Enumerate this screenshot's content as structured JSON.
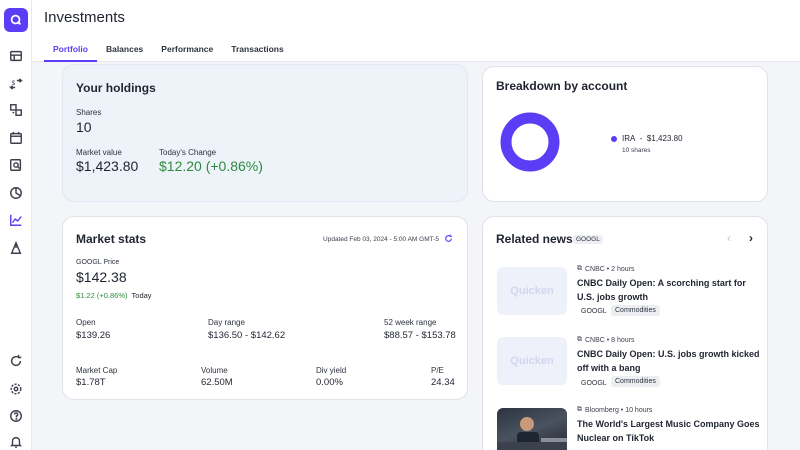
{
  "app": {
    "title": "Investments"
  },
  "tabs": [
    {
      "label": "Portfolio",
      "active": true
    },
    {
      "label": "Balances"
    },
    {
      "label": "Performance"
    },
    {
      "label": "Transactions"
    }
  ],
  "sidebar_icons": [
    "accounts-icon",
    "transfer-icon",
    "categories-icon",
    "calendar-icon",
    "reports-icon",
    "budget-pie-icon",
    "investments-chart-icon",
    "planning-icon",
    "sync-icon",
    "settings-icon",
    "help-icon",
    "notifications-icon"
  ],
  "holdings": {
    "title": "Your holdings",
    "shares_label": "Shares",
    "shares_value": "10",
    "market_value_label": "Market value",
    "market_value": "$1,423.80",
    "change_label": "Today's Change",
    "change_value": "$12.20 (+0.86%)"
  },
  "breakdown": {
    "title": "Breakdown by account",
    "account": "IRA",
    "separator": "-",
    "amount": "$1,423.80",
    "shares": "10 shares",
    "color": "#5b3df5"
  },
  "stats": {
    "title": "Market stats",
    "updated": "Updated Feb 03, 2024 - 5:00 AM GMT-5",
    "price_label": "GOOGL Price",
    "price": "$142.38",
    "change": "$1.22 (+0.86%)",
    "change_period": "Today",
    "open_label": "Open",
    "open": "$139.26",
    "day_range_label": "Day range",
    "day_range": "$136.50 - $142.62",
    "week52_label": "52 week range",
    "week52": "$88.57 - $153.78",
    "market_cap_label": "Market Cap",
    "market_cap": "$1.78T",
    "volume_label": "Volume",
    "volume": "62.50M",
    "div_yield_label": "Div yield",
    "div_yield": "0.00%",
    "pe_label": "P/E",
    "pe": "24.34"
  },
  "news": {
    "title": "Related news",
    "ticker": "GOOGL",
    "items": [
      {
        "thumb": "Quicken",
        "source": "CNBC • 2 hours",
        "headline": "CNBC Daily Open: A scorching start for U.S. jobs growth",
        "ticker": "GOOGL",
        "tag": "Commodities"
      },
      {
        "thumb": "Quicken",
        "source": "CNBC • 8 hours",
        "headline": "CNBC Daily Open: U.S. jobs growth kicked off with a bang",
        "ticker": "GOOGL",
        "tag": "Commodities"
      },
      {
        "thumb": "",
        "source": "Bloomberg • 10 hours",
        "headline": "The World's Largest Music Company Goes Nuclear on TikTok",
        "ticker": "",
        "tag": ""
      }
    ]
  }
}
